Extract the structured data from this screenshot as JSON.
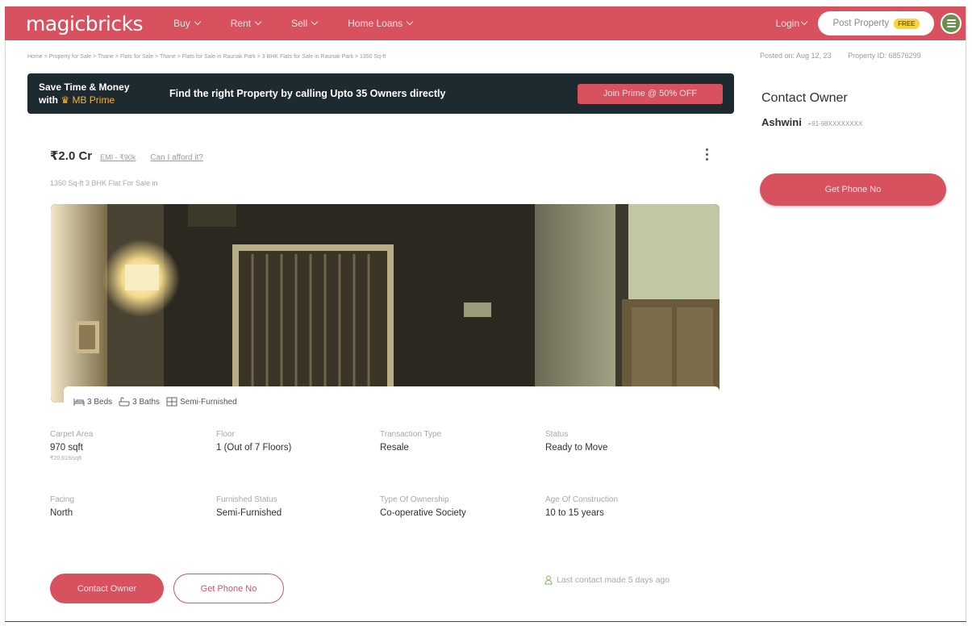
{
  "header": {
    "logo": "magicbricks",
    "nav": [
      {
        "label": "Buy"
      },
      {
        "label": "Rent"
      },
      {
        "label": "Sell"
      },
      {
        "label": "Home Loans"
      }
    ],
    "login_label": "Login",
    "post_property_label": "Post Property",
    "free_badge": "FREE",
    "brand_color": "#d8515f"
  },
  "breadcrumb": "Home > Property for Sale > Thane > Flats for Sale > Thane > Flats for Sale in Raunak Park > 3 BHK Flats for Sale in Raunak Park > 1350 Sq-ft",
  "posted_on": "Posted on: Aug 12, 23",
  "property_id": "Property ID: 68576299",
  "prime_banner": {
    "line1": "Save Time & Money",
    "line2_prefix": "with",
    "crown_icon": "crown-icon",
    "line2_brand": "MB Prime",
    "message": "Find the right Property by calling Upto 35 Owners directly",
    "cta": "Join Prime @ 50% OFF"
  },
  "contact_card": {
    "title": "Contact Owner",
    "owner_name": "Ashwini",
    "owner_phone": "+91-98XXXXXXXX",
    "phone_button": "Get Phone No"
  },
  "listing": {
    "price": "₹2.0 Cr",
    "emi": "EMI - ₹90k",
    "afford": "Can I afford it?",
    "subtitle": "1350 Sq-ft 3 BHK Flat For Sale in",
    "features": {
      "beds": "3 Beds",
      "baths": "3 Baths",
      "furnishing": "Semi-Furnished"
    },
    "details": [
      {
        "label": "Carpet Area",
        "value": "970 sqft",
        "sub": "₹20,619/sqft"
      },
      {
        "label": "Floor",
        "value": "1 (Out of 7 Floors)"
      },
      {
        "label": "Transaction Type",
        "value": "Resale"
      },
      {
        "label": "Status",
        "value": "Ready to Move"
      },
      {
        "label": "Facing",
        "value": "North"
      },
      {
        "label": "Furnished Status",
        "value": "Semi-Furnished"
      },
      {
        "label": "Type Of Ownership",
        "value": "Co-operative Society"
      },
      {
        "label": "Age Of Construction",
        "value": "10 to 15 years"
      }
    ],
    "contact_button": "Contact Owner",
    "phone_button": "Get Phone No",
    "last_contact": "Last contact made 5 days ago"
  }
}
